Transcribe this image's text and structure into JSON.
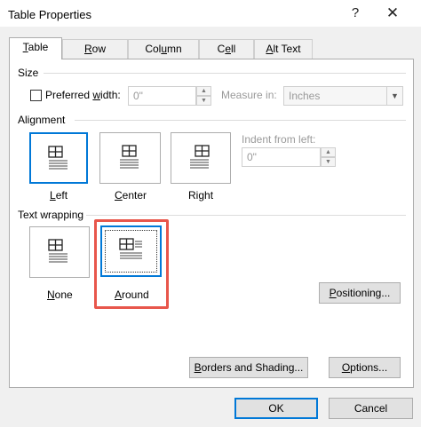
{
  "window": {
    "title": "Table Properties",
    "help_label": "?",
    "close_label": "✕"
  },
  "tabs": [
    {
      "label_pre": "",
      "label_acc": "T",
      "label_post": "able",
      "active": true
    },
    {
      "label_pre": "",
      "label_acc": "R",
      "label_post": "ow",
      "active": false
    },
    {
      "label_pre": "Col",
      "label_acc": "u",
      "label_post": "mn",
      "active": false
    },
    {
      "label_pre": "C",
      "label_acc": "e",
      "label_post": "ll",
      "active": false
    },
    {
      "label_pre": "",
      "label_acc": "A",
      "label_post": "lt Text",
      "active": false
    }
  ],
  "size": {
    "section_label": "Size",
    "preferred_width_pre": "Preferred ",
    "preferred_width_acc": "w",
    "preferred_width_post": "idth:",
    "preferred_width_checked": false,
    "preferred_width_value": "0\"",
    "measure_in_label": "Measure in:",
    "measure_in_value": "Inches"
  },
  "alignment": {
    "section_label": "Alignment",
    "options": [
      {
        "pre": "",
        "acc": "L",
        "post": "eft",
        "selected": true
      },
      {
        "pre": "",
        "acc": "C",
        "post": "enter",
        "selected": false
      },
      {
        "pre": "Ri",
        "acc": "g",
        "post": "ht",
        "selected": false
      }
    ],
    "indent_label": "Indent from left:",
    "indent_value": "0\""
  },
  "text_wrapping": {
    "section_label": "Text wrapping",
    "options": [
      {
        "pre": "",
        "acc": "N",
        "post": "one",
        "selected": false
      },
      {
        "pre": "",
        "acc": "A",
        "post": "round",
        "selected": true
      }
    ],
    "positioning_pre": "",
    "positioning_acc": "P",
    "positioning_post": "ositioning..."
  },
  "buttons": {
    "borders_pre": "",
    "borders_acc": "B",
    "borders_post": "orders and Shading...",
    "options_pre": "",
    "options_acc": "O",
    "options_post": "ptions...",
    "ok_label": "OK",
    "cancel_label": "Cancel"
  },
  "colors": {
    "selection_blue": "#0078d7",
    "highlight_red": "#e8564b"
  }
}
